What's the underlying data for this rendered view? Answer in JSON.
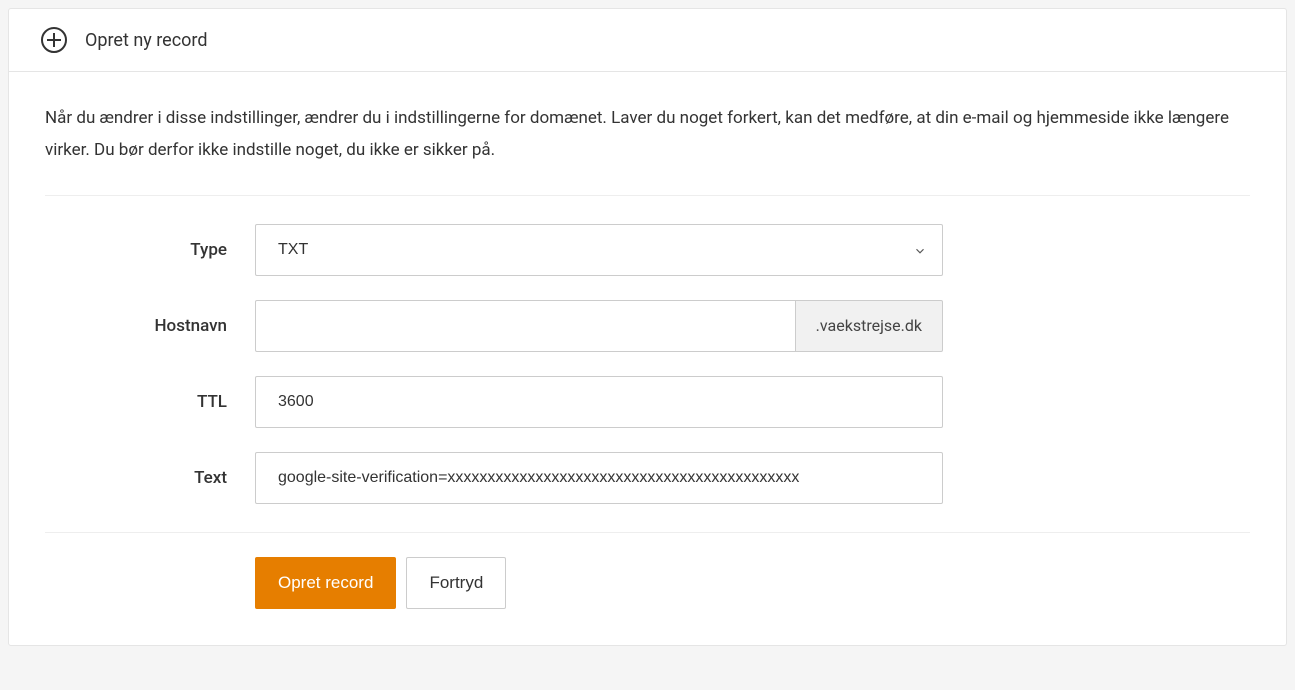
{
  "header": {
    "title": "Opret ny record"
  },
  "warning": "Når du ændrer i disse indstillinger, ændrer du i indstillingerne for domænet. Laver du noget forkert, kan det medføre, at din e-mail og hjemmeside ikke længere virker. Du bør derfor ikke indstille noget, du ikke er sikker på.",
  "form": {
    "type": {
      "label": "Type",
      "value": "TXT"
    },
    "hostname": {
      "label": "Hostnavn",
      "value": "",
      "suffix": ".vaekstrejse.dk"
    },
    "ttl": {
      "label": "TTL",
      "value": "3600"
    },
    "text": {
      "label": "Text",
      "value": "google-site-verification=xxxxxxxxxxxxxxxxxxxxxxxxxxxxxxxxxxxxxxxxxxxx"
    }
  },
  "buttons": {
    "submit": "Opret record",
    "cancel": "Fortryd"
  }
}
